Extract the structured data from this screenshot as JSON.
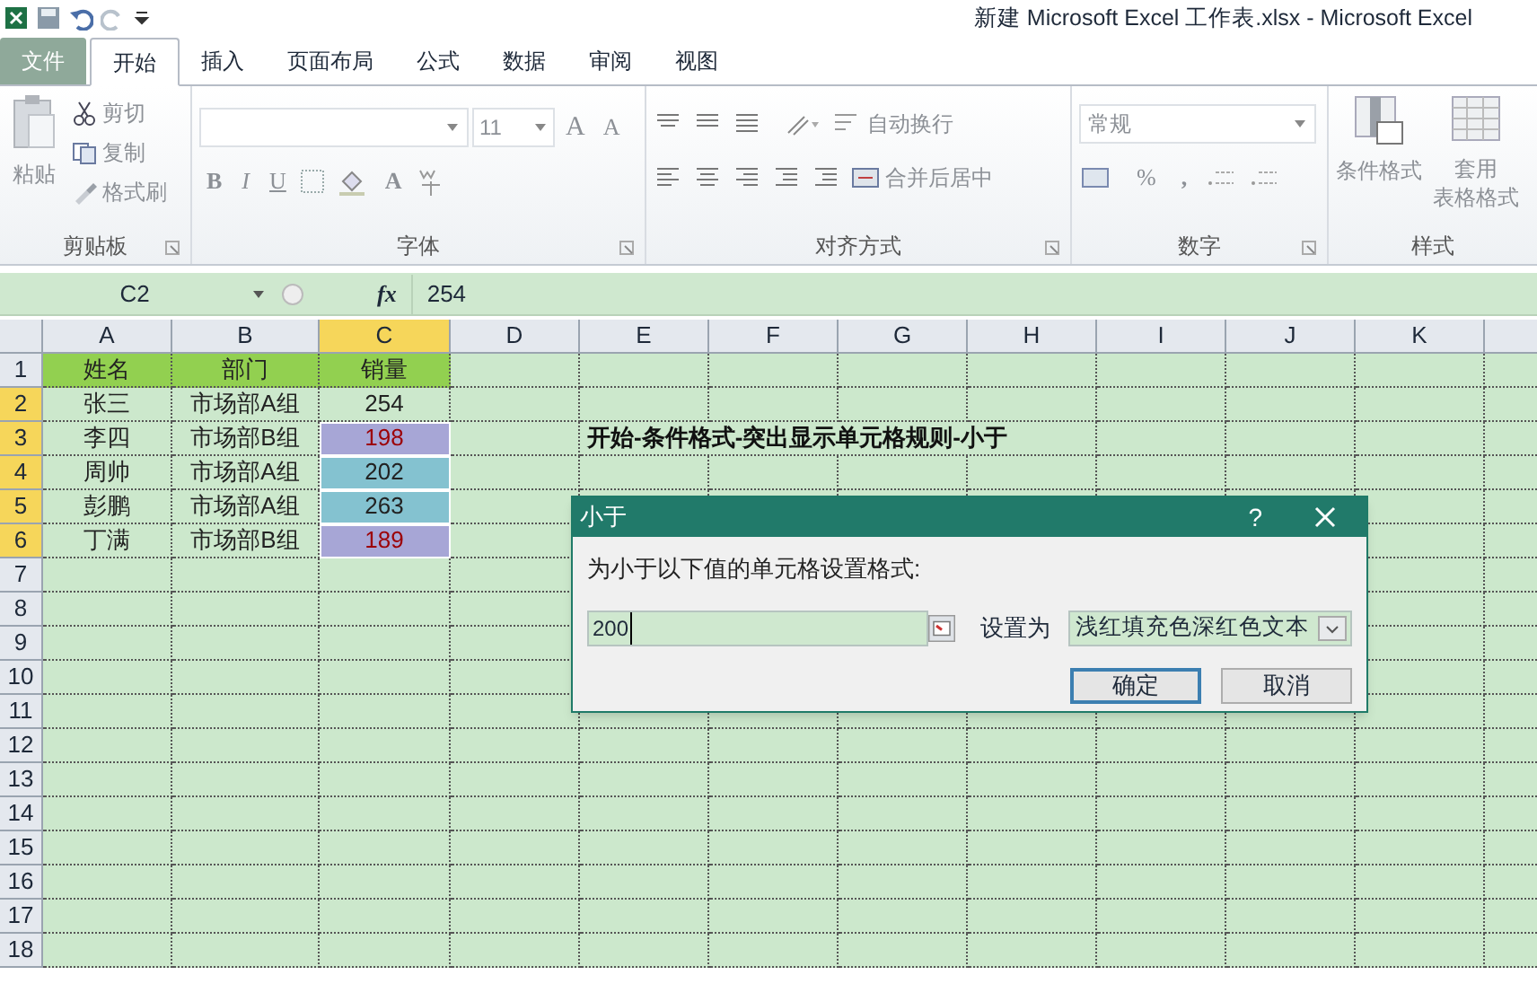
{
  "window": {
    "title": "新建 Microsoft Excel 工作表.xlsx  -  Microsoft Excel"
  },
  "tabs": [
    {
      "label": "文件",
      "kind": "file",
      "selected": false
    },
    {
      "label": "开始",
      "kind": "tab",
      "selected": true
    },
    {
      "label": "插入",
      "kind": "tab",
      "selected": false
    },
    {
      "label": "页面布局",
      "kind": "tab",
      "selected": false
    },
    {
      "label": "公式",
      "kind": "tab",
      "selected": false
    },
    {
      "label": "数据",
      "kind": "tab",
      "selected": false
    },
    {
      "label": "审阅",
      "kind": "tab",
      "selected": false
    },
    {
      "label": "视图",
      "kind": "tab",
      "selected": false
    }
  ],
  "ribbon": {
    "clipboard": {
      "label": "剪贴板",
      "paste": "粘贴",
      "cut": "剪切",
      "copy": "复制",
      "format_painter": "格式刷"
    },
    "font": {
      "label": "字体",
      "font_size": "11",
      "grow": "A",
      "shrink": "A",
      "bold": "B",
      "italic": "I",
      "underline": "U",
      "font_color": "A"
    },
    "alignment": {
      "label": "对齐方式",
      "wrap_text": "自动换行",
      "merge_center": "合并后居中"
    },
    "number": {
      "label": "数字",
      "format": "常规",
      "percent": "%",
      "comma": ","
    },
    "styles": {
      "label": "样式",
      "conditional": "条件格式",
      "table_format_1": "套用",
      "table_format_2": "表格格式"
    }
  },
  "formula_bar": {
    "name_box": "C2",
    "fx": "fx",
    "value": "254"
  },
  "sheet": {
    "columns": [
      {
        "label": "A",
        "selected": false
      },
      {
        "label": "B",
        "selected": false
      },
      {
        "label": "C",
        "selected": true
      },
      {
        "label": "D",
        "selected": false
      },
      {
        "label": "E",
        "selected": false
      },
      {
        "label": "F",
        "selected": false
      },
      {
        "label": "G",
        "selected": false
      },
      {
        "label": "H",
        "selected": false
      },
      {
        "label": "I",
        "selected": false
      },
      {
        "label": "J",
        "selected": false
      },
      {
        "label": "K",
        "selected": false
      }
    ],
    "rows": [
      {
        "number": "1",
        "selected": false,
        "cells": [
          {
            "value": "姓名",
            "kind": "header",
            "selected": false,
            "highlighted": false
          },
          {
            "value": "部门",
            "kind": "header",
            "selected": false,
            "highlighted": false
          },
          {
            "value": "销量",
            "kind": "header",
            "selected": false,
            "highlighted": false
          }
        ]
      },
      {
        "number": "2",
        "selected": true,
        "cells": [
          {
            "value": "张三",
            "kind": "data",
            "selected": false,
            "highlighted": false
          },
          {
            "value": "市场部A组",
            "kind": "data",
            "selected": false,
            "highlighted": false
          },
          {
            "value": "254",
            "kind": "data",
            "selected": false,
            "highlighted": false
          }
        ]
      },
      {
        "number": "3",
        "selected": true,
        "note": "开始-条件格式-突出显示单元格规则-小于",
        "cells": [
          {
            "value": "李四",
            "kind": "data",
            "selected": false,
            "highlighted": false
          },
          {
            "value": "市场部B组",
            "kind": "data",
            "selected": false,
            "highlighted": false
          },
          {
            "value": "198",
            "kind": "data",
            "selected": true,
            "highlighted": true
          }
        ]
      },
      {
        "number": "4",
        "selected": true,
        "cells": [
          {
            "value": "周帅",
            "kind": "data",
            "selected": false,
            "highlighted": false
          },
          {
            "value": "市场部A组",
            "kind": "data",
            "selected": false,
            "highlighted": false
          },
          {
            "value": "202",
            "kind": "data",
            "selected": true,
            "highlighted": false
          }
        ]
      },
      {
        "number": "5",
        "selected": true,
        "cells": [
          {
            "value": "彭鹏",
            "kind": "data",
            "selected": false,
            "highlighted": false
          },
          {
            "value": "市场部A组",
            "kind": "data",
            "selected": false,
            "highlighted": false
          },
          {
            "value": "263",
            "kind": "data",
            "selected": true,
            "highlighted": false
          }
        ]
      },
      {
        "number": "6",
        "selected": true,
        "cells": [
          {
            "value": "丁满",
            "kind": "data",
            "selected": false,
            "highlighted": false
          },
          {
            "value": "市场部B组",
            "kind": "data",
            "selected": false,
            "highlighted": false
          },
          {
            "value": "189",
            "kind": "data",
            "selected": true,
            "highlighted": true
          }
        ]
      },
      {
        "number": "7",
        "selected": false,
        "cells": []
      },
      {
        "number": "8",
        "selected": false,
        "cells": []
      },
      {
        "number": "9",
        "selected": false,
        "cells": []
      },
      {
        "number": "10",
        "selected": false,
        "cells": []
      },
      {
        "number": "11",
        "selected": false,
        "cells": []
      },
      {
        "number": "12",
        "selected": false,
        "cells": []
      },
      {
        "number": "13",
        "selected": false,
        "cells": []
      },
      {
        "number": "14",
        "selected": false,
        "cells": []
      },
      {
        "number": "15",
        "selected": false,
        "cells": []
      },
      {
        "number": "16",
        "selected": false,
        "cells": []
      },
      {
        "number": "17",
        "selected": false,
        "cells": []
      },
      {
        "number": "18",
        "selected": false,
        "cells": []
      }
    ]
  },
  "dialog": {
    "title": "小于",
    "help": "?",
    "prompt": "为小于以下值的单元格设置格式:",
    "value": "200",
    "set_label": "设置为",
    "format": "浅红填充色深红色文本",
    "buttons": [
      {
        "label": "确定",
        "default": true
      },
      {
        "label": "取消",
        "default": false
      }
    ]
  }
}
